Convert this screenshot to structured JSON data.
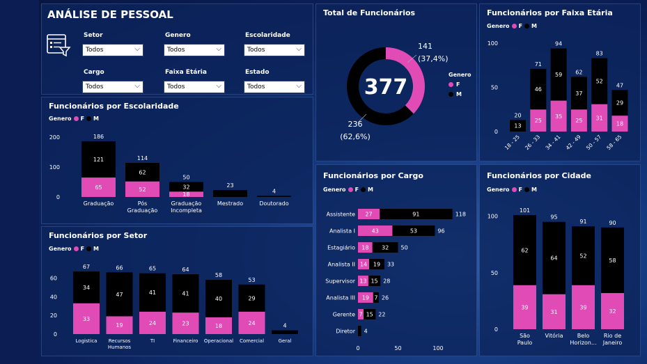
{
  "header": {
    "title": "ANÁLISE DE PESSOAL"
  },
  "filters": [
    {
      "label": "Setor",
      "value": "Todos"
    },
    {
      "label": "Genero",
      "value": "Todos"
    },
    {
      "label": "Escolaridade",
      "value": "Todos"
    },
    {
      "label": "Cargo",
      "value": "Todos"
    },
    {
      "label": "Faixa Etária",
      "value": "Todos"
    },
    {
      "label": "Estado",
      "value": "Todos"
    }
  ],
  "colors": {
    "F": "#e04bb5",
    "M": "#000000"
  },
  "legend": {
    "title": "Genero",
    "f": "F",
    "m": "M"
  },
  "chart_data": [
    {
      "id": "total",
      "type": "pie",
      "title": "Total de Funcionários",
      "center_label": "377",
      "categories": [
        "F",
        "M"
      ],
      "values": [
        141,
        236
      ],
      "data_labels": [
        "141",
        "(37,4%)",
        "236",
        "(62,6%)"
      ]
    },
    {
      "id": "escolaridade",
      "type": "bar",
      "title": "Funcionários por Escolaridade",
      "categories": [
        "Graduação",
        "Pós Graduação",
        "Graduação Incompleta",
        "Mestrado",
        "Doutorado"
      ],
      "series": [
        {
          "name": "F",
          "values": [
            65,
            52,
            18,
            0,
            0
          ]
        },
        {
          "name": "M",
          "values": [
            121,
            62,
            32,
            23,
            4
          ]
        }
      ],
      "totals": [
        186,
        114,
        50,
        23,
        4
      ],
      "yticks": [
        0,
        100,
        200
      ],
      "ylim": [
        0,
        200
      ]
    },
    {
      "id": "setor",
      "type": "bar",
      "title": "Funcionários por Setor",
      "categories": [
        "Logistica",
        "Recursos Humanos",
        "TI",
        "Financeiro",
        "Operacional",
        "Comercial",
        "Geral"
      ],
      "series": [
        {
          "name": "F",
          "values": [
            33,
            19,
            24,
            23,
            18,
            24,
            0
          ]
        },
        {
          "name": "M",
          "values": [
            34,
            47,
            41,
            41,
            40,
            29,
            4
          ]
        }
      ],
      "totals": [
        67,
        66,
        65,
        64,
        58,
        53,
        4
      ],
      "yticks": [
        0,
        20,
        40,
        60
      ],
      "ylim": [
        0,
        67
      ]
    },
    {
      "id": "cargo",
      "type": "bar",
      "orientation": "horizontal",
      "title": "Funcionários por Cargo",
      "categories": [
        "Assistente",
        "Analista I",
        "Estagiário",
        "Analista II",
        "Supervisor",
        "Analista III",
        "Gerente",
        "Diretor"
      ],
      "series": [
        {
          "name": "F",
          "values": [
            27,
            43,
            18,
            14,
            13,
            19,
            7,
            0
          ]
        },
        {
          "name": "M",
          "values": [
            91,
            53,
            32,
            19,
            15,
            7,
            15,
            4
          ]
        }
      ],
      "totals": [
        118,
        96,
        50,
        33,
        28,
        26,
        22,
        4
      ],
      "xticks": [
        0,
        50,
        100
      ],
      "xlim": [
        0,
        118
      ]
    },
    {
      "id": "faixa",
      "type": "bar",
      "title": "Funcionários por Faixa Etária",
      "categories": [
        "18 - 25",
        "26 - 33",
        "34 - 41",
        "42 - 49",
        "50 - 57",
        "58 - 65"
      ],
      "series": [
        {
          "name": "F",
          "values": [
            0,
            25,
            35,
            25,
            31,
            18
          ]
        },
        {
          "name": "M",
          "values": [
            13,
            46,
            59,
            37,
            52,
            29
          ]
        }
      ],
      "totals": [
        20,
        71,
        94,
        62,
        83,
        47
      ],
      "yticks": [
        0,
        50,
        100
      ],
      "ylim": [
        0,
        100
      ]
    },
    {
      "id": "cidade",
      "type": "bar",
      "title": "Funcionários por Cidade",
      "categories": [
        "São Paulo",
        "Vitória",
        "Belo Horizon...",
        "Rio de Janeiro"
      ],
      "series": [
        {
          "name": "F",
          "values": [
            39,
            31,
            39,
            32
          ]
        },
        {
          "name": "M",
          "values": [
            62,
            64,
            52,
            58
          ]
        }
      ],
      "totals": [
        101,
        95,
        91,
        90
      ],
      "yticks": [
        0,
        50,
        100
      ],
      "ylim": [
        0,
        101
      ]
    }
  ]
}
